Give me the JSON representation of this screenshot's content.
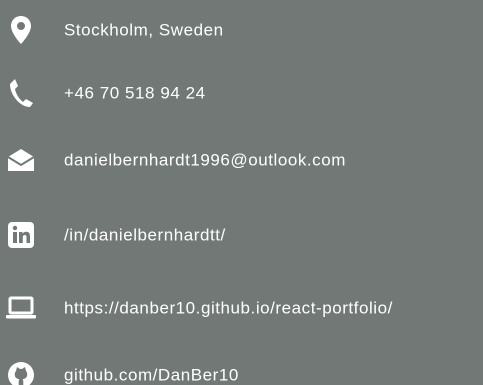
{
  "contacts": {
    "location": {
      "label": "Stockholm, Sweden",
      "icon": "map-pin-icon"
    },
    "phone": {
      "label": "+46 70 518 94 24",
      "icon": "phone-icon"
    },
    "email": {
      "label": "danielbernhardt1996@outlook.com",
      "icon": "envelope-icon"
    },
    "linkedin": {
      "label": "/in/danielbernhardtt/",
      "icon": "linkedin-icon"
    },
    "website": {
      "label": "https://danber10.github.io/react-portfolio/",
      "icon": "laptop-icon"
    },
    "github": {
      "label": "github.com/DanBer10",
      "icon": "github-icon"
    }
  },
  "colors": {
    "background": "#717875",
    "text": "#ffffff",
    "icon": "#ffffff"
  }
}
